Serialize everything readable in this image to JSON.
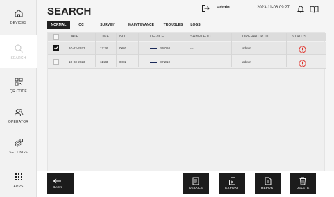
{
  "sidebar": {
    "items": [
      {
        "label": "DEVICES"
      },
      {
        "label": "SEARCH"
      },
      {
        "label": "QR CODE"
      },
      {
        "label": "OPERATOR"
      },
      {
        "label": "SETTINGS"
      },
      {
        "label": "APPS"
      }
    ]
  },
  "header": {
    "title": "SEARCH",
    "user": "admin",
    "datetime": "2023-11-06  09:27"
  },
  "tabs": [
    {
      "label": "NORMAL"
    },
    {
      "label": "QC"
    },
    {
      "label": "SURVEY"
    },
    {
      "label": "MAINTENANCE"
    },
    {
      "label": "TROUBLES"
    },
    {
      "label": "LOGS"
    }
  ],
  "table": {
    "columns": [
      "DATE",
      "TIME",
      "NO.",
      "DEVICE",
      "SAMPLE ID",
      "OPERATOR ID",
      "STATUS"
    ],
    "rows": [
      {
        "checked": true,
        "date": "10-02-2023",
        "time": "17:26",
        "no": "0001",
        "device": "SN010",
        "sample_id": "---",
        "operator_id": "admin",
        "status": "error"
      },
      {
        "checked": false,
        "date": "10-03-2023",
        "time": "11:23",
        "no": "0002",
        "device": "SN010",
        "sample_id": "---",
        "operator_id": "admin",
        "status": "error"
      }
    ]
  },
  "footer": {
    "back": "BACK",
    "details": "DETAILS",
    "export": "EXPORT",
    "report": "REPORT",
    "delete": "DELETE"
  },
  "colors": {
    "accent": "#1c1c1c",
    "error": "#e0322b",
    "device_line": "#1b2a5a"
  }
}
